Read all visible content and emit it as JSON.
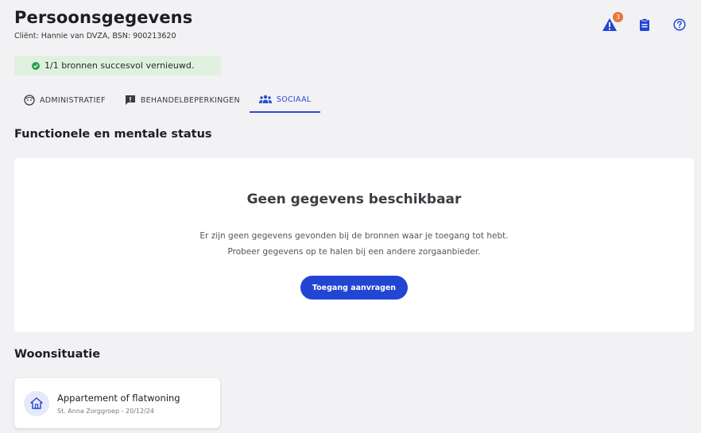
{
  "header": {
    "title": "Persoonsgegevens",
    "client_line": "Cliënt: Hannie van DVZA, BSN: 900213620",
    "warning_count": "3"
  },
  "notice": {
    "text": "1/1 bronnen succesvol vernieuwd."
  },
  "tabs": [
    {
      "label": "ADMINISTRATIEF",
      "icon": "face-icon"
    },
    {
      "label": "BEHANDELBEPERKINGEN",
      "icon": "alert-box-icon"
    },
    {
      "label": "SOCIAAL",
      "icon": "group-icon",
      "active": true
    }
  ],
  "functional": {
    "title": "Functionele en mentale status",
    "empty_title": "Geen gegevens beschikbaar",
    "empty_line1": "Er zijn geen gegevens gevonden bij de bronnen waar je toegang tot hebt.",
    "empty_line2": "Probeer gegevens op te halen bij een andere zorgaanbieder.",
    "button_label": "Toegang aanvragen"
  },
  "living": {
    "title": "Woonsituatie",
    "card_title": "Appartement of flatwoning",
    "card_sub": "St. Anna Zorggroep - 20/12/24"
  },
  "colors": {
    "accent": "#2245d3",
    "success": "#2e9e4a",
    "badge": "#e8743b"
  }
}
